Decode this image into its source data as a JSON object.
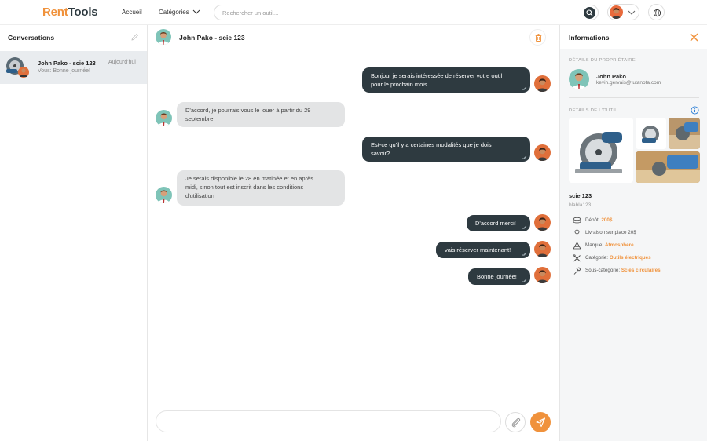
{
  "app": {
    "logo_part1": "Rent",
    "logo_part2": "Tools"
  },
  "nav": {
    "home": "Accueil",
    "categories": "Catégories"
  },
  "search": {
    "placeholder": "Rechercher un outil..."
  },
  "sidebar": {
    "title": "Conversations",
    "conversations": [
      {
        "name": "John Pako - scie 123",
        "date": "Aujourd'hui",
        "last_message": "Vous: Bonne journée!"
      }
    ]
  },
  "chat": {
    "title": "John Pako - scie 123",
    "messages": [
      {
        "dir": "out",
        "line1": "Bonjour je serais intéressée de réserver votre outil",
        "line2": "pour le prochain mois"
      },
      {
        "dir": "in",
        "line1": "D'accord, je pourrais vous le louer à partir du 29",
        "line2": "septembre"
      },
      {
        "dir": "out",
        "line1": "Est-ce qu'il y a certaines modalités que je dois",
        "line2": "savoir?"
      },
      {
        "dir": "in",
        "line1": "Je serais disponible le 28 en matinée et en après",
        "line2": "midi, sinon tout est inscrit dans les conditions",
        "line3": "d'utilisation"
      },
      {
        "dir": "out",
        "line1": "D'accord merci!"
      },
      {
        "dir": "out",
        "line1": "vais réserver maintenant!"
      },
      {
        "dir": "out",
        "line1": "Bonne journée!"
      }
    ],
    "composer_placeholder": ""
  },
  "info": {
    "title": "Informations",
    "owner_section": "DÉTAILS DU PROPRIÉTAIRE",
    "owner_name": "John Pako",
    "owner_email": "kevin.gervais@tutanota.com",
    "tool_section": "DÉTAILS DE L'OUTIL",
    "tool_name": "scie 123",
    "tool_desc": "blabla123",
    "details": {
      "deposit_label": "Dépôt: ",
      "deposit_value": "200$",
      "delivery": "Livraison sur place 20$",
      "brand_label": "Marque: ",
      "brand_value": "Atmosphere",
      "category_label": "Catégorie: ",
      "category_value": "Outils électriques",
      "subcategory_label": "Sous-catégorie: ",
      "subcategory_value": "Scies circulaires"
    }
  },
  "colors": {
    "accent": "#f0923c",
    "dark": "#2e3a40",
    "bubble_in": "#e3e4e5"
  }
}
